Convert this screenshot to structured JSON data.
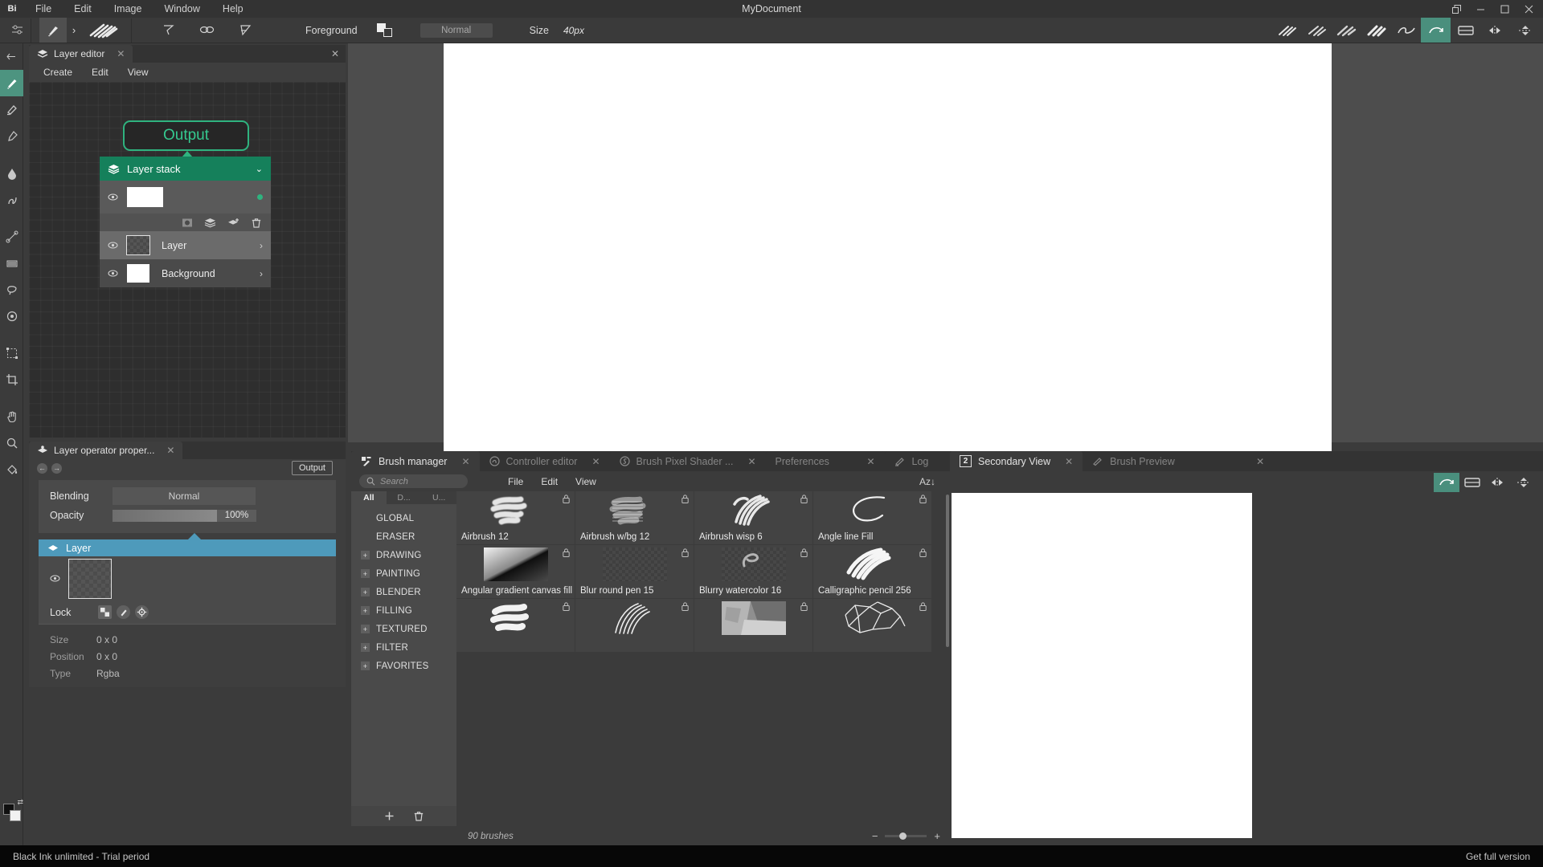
{
  "window": {
    "title": "MyDocument",
    "logo": "Bi",
    "menu": [
      "File",
      "Edit",
      "Image",
      "Window",
      "Help"
    ],
    "controls": [
      "minimize-restore",
      "minimize",
      "maximize",
      "close"
    ]
  },
  "toolbar": {
    "settings_icon": "sliders-icon",
    "brush_icon": "brush-icon",
    "brush_more": "›",
    "brush_preview": "brush-stroke-preview",
    "tool_icons": [
      "ruler-triangle-icon",
      "chain-link-icon",
      "angle-icon"
    ],
    "foreground_label": "Foreground",
    "color_swatch": "foreground-background-swatch",
    "blending_mode": "Normal",
    "size_label": "Size",
    "size_value": "40px",
    "right_icons": [
      "brush-stroke-1-icon",
      "brush-stroke-2-icon",
      "brush-stroke-3-icon",
      "brush-stroke-4-icon",
      "brush-stroke-5-icon",
      "canvas-rotate-icon",
      "canvas-view-icon",
      "mirror-horizontal-icon",
      "mirror-vertical-icon"
    ]
  },
  "toolrail": {
    "items": [
      "collapse-rail-icon",
      "paintbrush-tool",
      "eraser-tool",
      "eyedropper-tool",
      "ink-drop-tool",
      "smudge-tool",
      "node-graph-tool",
      "gradient-tool",
      "lasso-tool",
      "stamp-tool",
      "transform-tool",
      "crop-tool",
      "pan-tool",
      "zoom-tool",
      "bucket-fill-tool"
    ],
    "color_swatch": "foreground-background-color"
  },
  "layer_editor": {
    "tab_title": "Layer editor",
    "tab_icon": "layers-icon",
    "submenu": [
      "Create",
      "Edit",
      "View"
    ],
    "node": {
      "label": "Output"
    },
    "layer_stack": {
      "title": "Layer stack",
      "icon": "layers-icon",
      "collapse_icon": "chevron-down-icon",
      "tools": [
        "mask-icon",
        "duplicate-layers-icon",
        "add-layer-icon",
        "trash-icon"
      ],
      "rows": [
        {
          "name": "",
          "thumb": "white",
          "visible": true,
          "selected": false,
          "has_dot": true
        },
        {
          "name": "Layer",
          "thumb": "checker",
          "visible": true,
          "selected": true,
          "has_dot": false
        },
        {
          "name": "Background",
          "thumb": "white",
          "visible": true,
          "selected": false,
          "has_dot": false
        }
      ]
    }
  },
  "layer_props": {
    "tab_title": "Layer operator proper...",
    "tab_icon": "layer-operator-icon",
    "nav_back": "←",
    "nav_forward": "→",
    "output_button": "Output",
    "blending_label": "Blending",
    "blending_value": "Normal",
    "opacity_label": "Opacity",
    "opacity_value": "100%",
    "opacity_percent": 100,
    "selected_layer": "Layer",
    "lock_label": "Lock",
    "lock_buttons": [
      "lock-transparency-icon",
      "lock-paint-icon",
      "lock-position-icon"
    ],
    "info": [
      {
        "label": "Size",
        "value": "0 x 0"
      },
      {
        "label": "Position",
        "value": "0 x 0"
      },
      {
        "label": "Type",
        "value": "Rgba"
      }
    ]
  },
  "bottom_dock": {
    "tabs": [
      {
        "label": "Brush manager",
        "icon": "brush-manager-icon",
        "active": true,
        "closable": true
      },
      {
        "label": "Controller editor",
        "icon": "controller-icon",
        "active": false,
        "closable": true
      },
      {
        "label": "Brush Pixel Shader ...",
        "icon": "shader-icon",
        "active": false,
        "closable": true
      },
      {
        "label": "Preferences",
        "icon": "preferences-icon",
        "active": false,
        "closable": true
      },
      {
        "label": "Log",
        "icon": "log-pencil-icon",
        "active": false,
        "closable": true
      }
    ]
  },
  "brush_manager": {
    "search_placeholder": "Search",
    "search_icon": "search-icon",
    "menus": [
      "File",
      "Edit",
      "View"
    ],
    "sort_label": "Az↓",
    "category_tabs": [
      {
        "label": "All",
        "active": true
      },
      {
        "label": "D...",
        "active": false
      },
      {
        "label": "U...",
        "active": false
      }
    ],
    "categories": [
      {
        "label": "GLOBAL",
        "expandable": false
      },
      {
        "label": "ERASER",
        "expandable": false
      },
      {
        "label": "DRAWING",
        "expandable": true
      },
      {
        "label": "PAINTING",
        "expandable": true
      },
      {
        "label": "BLENDER",
        "expandable": true
      },
      {
        "label": "FILLING",
        "expandable": true
      },
      {
        "label": "TEXTURED",
        "expandable": true
      },
      {
        "label": "FILTER",
        "expandable": true
      },
      {
        "label": "FAVORITES",
        "expandable": true
      }
    ],
    "category_footer": [
      "add-category-icon",
      "delete-category-icon"
    ],
    "brushes": [
      {
        "name": "Airbrush 12",
        "preview": "soft-scribble",
        "locked": true
      },
      {
        "name": "Airbrush w/bg 12",
        "preview": "grainy-scribble",
        "locked": true
      },
      {
        "name": "Airbrush wisp 6",
        "preview": "streak-strokes",
        "locked": true
      },
      {
        "name": "Angle line Fill",
        "preview": "thin-curve",
        "locked": true
      },
      {
        "name": "Angular gradient canvas fill",
        "preview": "angular-gradient",
        "locked": true
      },
      {
        "name": "Blur round pen 15",
        "preview": "empty-checker",
        "locked": true
      },
      {
        "name": "Blurry watercolor 16",
        "preview": "faint-curve",
        "locked": true
      },
      {
        "name": "Calligraphic pencil 256",
        "preview": "bold-scribble",
        "locked": true
      },
      {
        "name": "",
        "preview": "thick-scribble",
        "locked": true
      },
      {
        "name": "",
        "preview": "line-scribble",
        "locked": true
      },
      {
        "name": "",
        "preview": "textured-patch",
        "locked": true
      },
      {
        "name": "",
        "preview": "cell-network",
        "locked": true
      }
    ],
    "brush_count": "90 brushes",
    "zoom": {
      "minus": "−",
      "plus": "+",
      "position": 30
    }
  },
  "secondary_view": {
    "tabs": [
      {
        "label": "Secondary View",
        "badge": "2",
        "active": true,
        "closable": true
      },
      {
        "label": "Brush Preview",
        "icon": "brush-preview-icon",
        "active": false,
        "closable": true
      }
    ],
    "toolbar_icons": [
      "canvas-rotate-icon",
      "canvas-view-icon",
      "mirror-horizontal-icon",
      "mirror-vertical-icon"
    ]
  },
  "status_bar": {
    "trial_text": "Black Ink unlimited - Trial period",
    "full_version_text": "Get full version"
  },
  "colors": {
    "accent_green": "#2fb37f",
    "header_green": "#15805b",
    "selection_blue": "#4e9abb",
    "panel_bg": "#3e3e3e",
    "window_bg": "#3b3b3b",
    "toolbar_bg": "#3a3a3a"
  }
}
